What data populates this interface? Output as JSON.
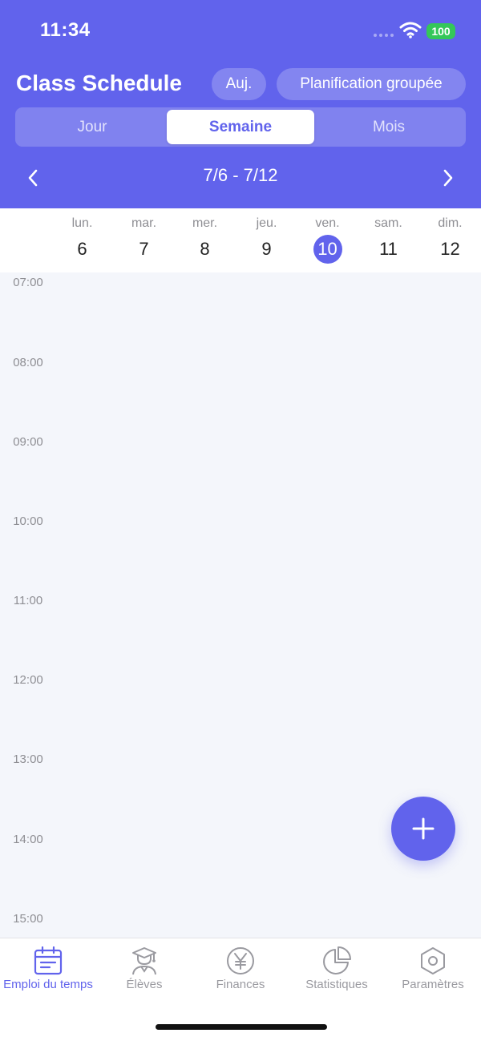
{
  "status": {
    "time": "11:34",
    "battery": "100"
  },
  "header": {
    "title": "Class Schedule",
    "today_label": "Auj.",
    "group_label": "Planification groupée",
    "views": {
      "day": "Jour",
      "week": "Semaine",
      "month": "Mois",
      "selected": "week"
    },
    "range": "7/6 - 7/12",
    "prev_icon": "chevron-left-icon",
    "next_icon": "chevron-right-icon"
  },
  "days": [
    {
      "name": "lun.",
      "num": "6"
    },
    {
      "name": "mar.",
      "num": "7"
    },
    {
      "name": "mer.",
      "num": "8"
    },
    {
      "name": "jeu.",
      "num": "9"
    },
    {
      "name": "ven.",
      "num": "10",
      "today": true
    },
    {
      "name": "sam.",
      "num": "11"
    },
    {
      "name": "dim.",
      "num": "12"
    }
  ],
  "hours": [
    "07:00",
    "08:00",
    "09:00",
    "10:00",
    "11:00",
    "12:00",
    "13:00",
    "14:00",
    "15:00"
  ],
  "fab_icon": "plus-icon",
  "tabs": [
    {
      "label": "Emploi du temps",
      "icon": "calendar-icon",
      "active": true
    },
    {
      "label": "Élèves",
      "icon": "student-icon"
    },
    {
      "label": "Finances",
      "icon": "yen-icon"
    },
    {
      "label": "Statistiques",
      "icon": "pie-chart-icon"
    },
    {
      "label": "Paramètres",
      "icon": "hexagon-settings-icon"
    }
  ],
  "colors": {
    "accent": "#6163ec",
    "background": "#f4f6fb",
    "battery": "#34c759"
  }
}
